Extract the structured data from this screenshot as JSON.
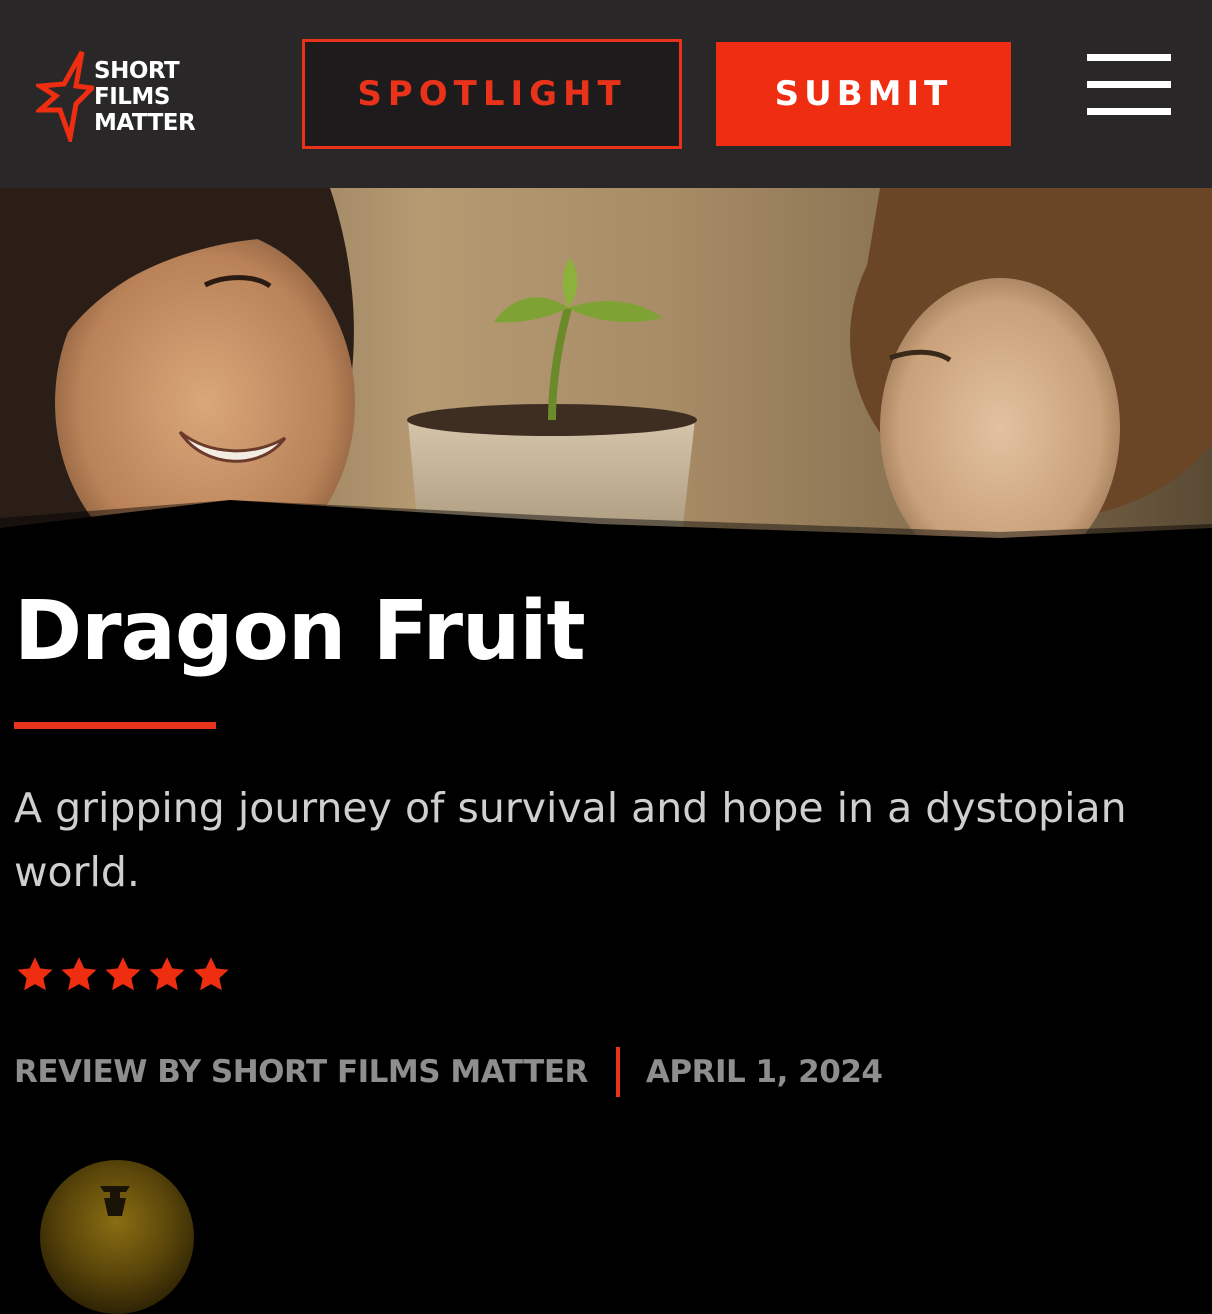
{
  "header": {
    "logo": {
      "line1": "SHORT",
      "line2": "FILMS",
      "line3": "MATTER",
      "icon": "star-logo-icon"
    },
    "spotlight_label": "SPOTLIGHT",
    "submit_label": "SUBMIT",
    "menu_icon": "hamburger-menu-icon"
  },
  "hero": {
    "alt": "Film still: a smiling woman and a curly-haired boy looking at a sprouting seedling in a cup"
  },
  "article": {
    "title": "Dragon Fruit",
    "tagline": "A gripping journey of survival and hope in a dystopian world.",
    "rating": 5,
    "rating_max": 5,
    "byline": "REVIEW BY SHORT FILMS MATTER",
    "date": "APRIL 1, 2024"
  },
  "colors": {
    "accent": "#ef2d11",
    "header_bg": "#292728",
    "page_bg": "#000000",
    "meta_text": "#8e8e8e"
  }
}
